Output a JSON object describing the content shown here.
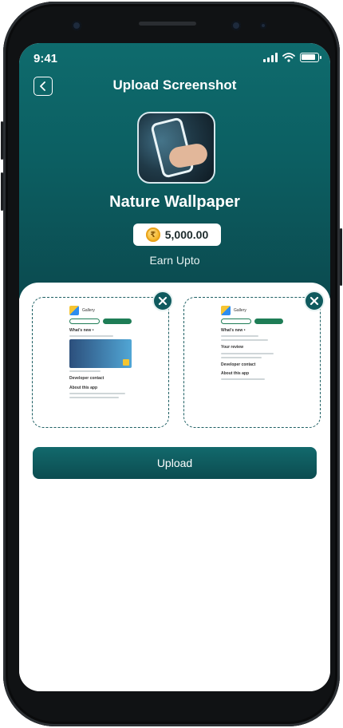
{
  "status_bar": {
    "time": "9:41"
  },
  "header": {
    "title": "Upload Screenshot"
  },
  "app": {
    "name": "Nature Wallpaper"
  },
  "reward": {
    "coin_symbol": "₹",
    "amount": "5,000.00",
    "label": "Earn Upto"
  },
  "screenshots": [
    {
      "app_title": "Gallery",
      "whats_new": "What's new •",
      "developer_contact": "Developer contact",
      "about": "About this app"
    },
    {
      "app_title": "Gallery",
      "whats_new": "What's new •",
      "your_review": "Your review",
      "developer_contact": "Developer contact",
      "about": "About this app"
    }
  ],
  "actions": {
    "upload_label": "Upload"
  },
  "colors": {
    "primary": "#0e6b6d",
    "primary_dark": "#0b4a4f",
    "chip_bg": "#ffffff",
    "coin": "#f4b62a"
  }
}
